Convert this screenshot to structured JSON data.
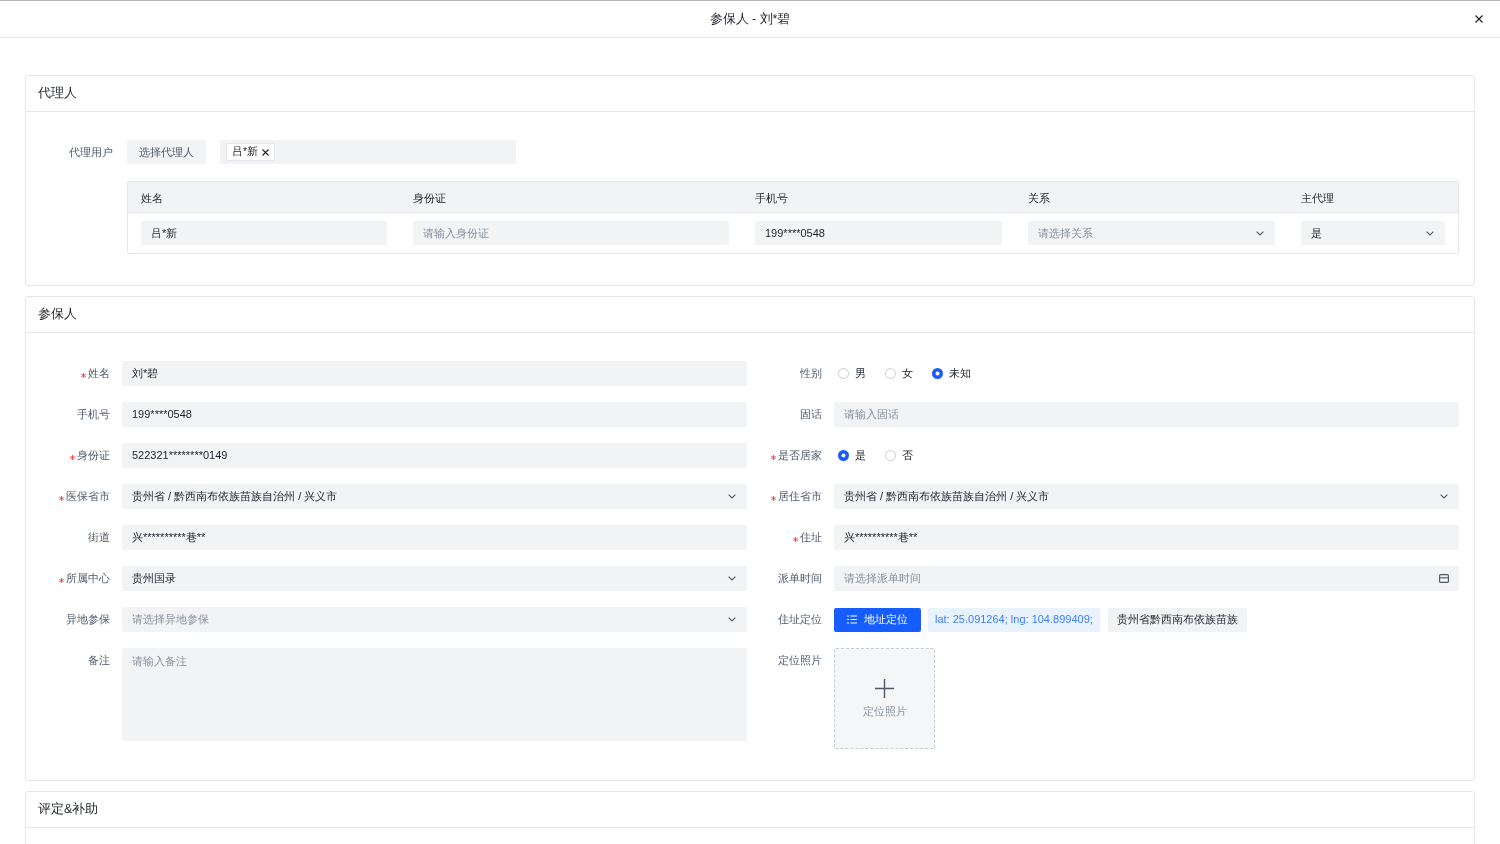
{
  "dialog": {
    "title": "参保人 - 刘*碧"
  },
  "sections": [
    {
      "kind": "agent",
      "title": "代理人",
      "agent_user": {
        "label": "代理用户",
        "button": "选择代理人",
        "tags": [
          {
            "label": "吕*新"
          }
        ]
      },
      "table": {
        "columns": [
          "姓名",
          "身份证",
          "手机号",
          "关系",
          "主代理"
        ],
        "rows": [
          {
            "cells": [
              {
                "kind": "input",
                "value": "吕*新"
              },
              {
                "kind": "input",
                "placeholder": "请输入身份证"
              },
              {
                "kind": "input",
                "value": "199****0548"
              },
              {
                "kind": "select",
                "placeholder": "请选择关系"
              },
              {
                "kind": "select",
                "value": "是"
              }
            ]
          }
        ]
      }
    },
    {
      "kind": "insured",
      "title": "参保人",
      "left_fields": [
        {
          "label": "姓名",
          "required": true,
          "kind": "input",
          "value": "刘*碧"
        },
        {
          "label": "手机号",
          "required": false,
          "kind": "input",
          "value": "199****0548"
        },
        {
          "label": "身份证",
          "required": true,
          "kind": "input",
          "value": "522321********0149"
        },
        {
          "label": "医保省市",
          "required": true,
          "kind": "select",
          "value": "贵州省 / 黔西南布依族苗族自治州 / 兴义市"
        },
        {
          "label": "街道",
          "required": false,
          "kind": "input",
          "value": "兴**********巷**"
        },
        {
          "label": "所属中心",
          "required": true,
          "kind": "select",
          "value": "贵州国录"
        },
        {
          "label": "异地参保",
          "required": false,
          "kind": "select",
          "placeholder": "请选择异地参保"
        },
        {
          "label": "备注",
          "required": false,
          "kind": "textarea",
          "placeholder": "请输入备注"
        }
      ],
      "right_fields": [
        {
          "label": "性别",
          "required": false,
          "kind": "radio",
          "options": [
            {
              "label": "男",
              "selected": false
            },
            {
              "label": "女",
              "selected": false
            },
            {
              "label": "未知",
              "selected": true
            }
          ]
        },
        {
          "label": "固话",
          "required": false,
          "kind": "input",
          "placeholder": "请输入固话"
        },
        {
          "label": "是否居家",
          "required": true,
          "kind": "radio",
          "options": [
            {
              "label": "是",
              "selected": true
            },
            {
              "label": "否",
              "selected": false
            }
          ]
        },
        {
          "label": "居住省市",
          "required": true,
          "kind": "select",
          "value": "贵州省 / 黔西南布依族苗族自治州 / 兴义市"
        },
        {
          "label": "住址",
          "required": true,
          "kind": "input",
          "value": "兴**********巷**"
        },
        {
          "label": "派单时间",
          "required": false,
          "kind": "date",
          "placeholder": "请选择派单时间"
        },
        {
          "label": "住址定位",
          "required": false,
          "kind": "location",
          "button": "地址定位",
          "coordinates": "lat: 25.091264; lng: 104.899409;",
          "address": "贵州省黔西南布依族苗族"
        },
        {
          "label": "定位照片",
          "required": false,
          "kind": "upload",
          "text": "定位照片"
        }
      ]
    },
    {
      "kind": "collapsed",
      "title": "评定&补助"
    }
  ]
}
